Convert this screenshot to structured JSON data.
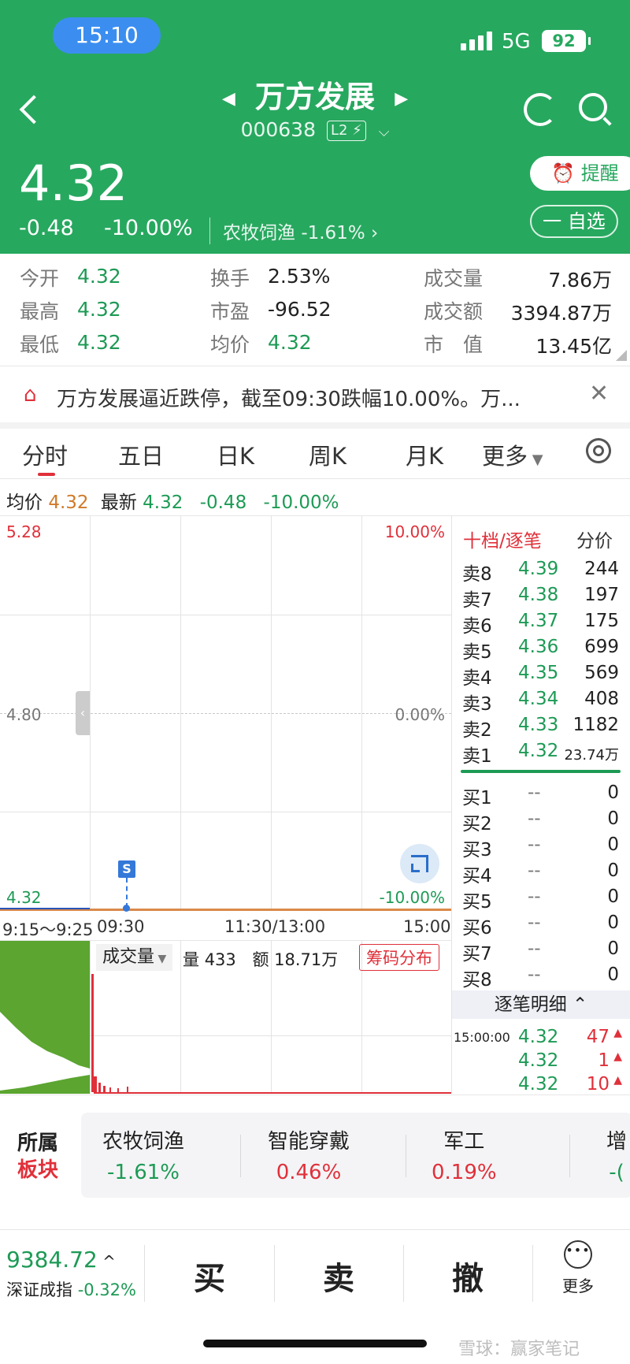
{
  "status": {
    "time": "15:10",
    "network": "5G",
    "battery": "92"
  },
  "header": {
    "name": "万方发展",
    "code": "000638",
    "level": "L2",
    "price": "4.32",
    "change": "-0.48",
    "change_pct": "-10.00%",
    "sector": "农牧饲渔",
    "sector_pct": "-1.61%",
    "remind_label": "提醒",
    "watch_label": "一 自选",
    "bg_color": "#27a85f"
  },
  "stats": [
    [
      {
        "label": "今开",
        "value": "4.32"
      },
      {
        "label": "换手",
        "value": "2.53%"
      },
      {
        "label": "成交量",
        "value": "7.86万"
      }
    ],
    [
      {
        "label": "最高",
        "value": "4.32"
      },
      {
        "label": "市盈",
        "value": "-96.52"
      },
      {
        "label": "成交额",
        "value": "3394.87万"
      }
    ],
    [
      {
        "label": "最低",
        "value": "4.32"
      },
      {
        "label": "均价",
        "value": "4.32"
      },
      {
        "label": "市　值",
        "value": "13.45亿"
      }
    ]
  ],
  "notice": {
    "text": "万方发展逼近跌停，截至09:30跌幅10.00%。万..."
  },
  "tabs": [
    "分时",
    "五日",
    "日K",
    "周K",
    "月K",
    "更多"
  ],
  "active_tab": "分时",
  "info_bar": {
    "avg_label": "均价",
    "avg_value": "4.32",
    "latest_label": "最新",
    "latest_value": "4.32",
    "change": "-0.48",
    "change_pct": "-10.00%"
  },
  "chart": {
    "y_high": "5.28",
    "y_mid": "4.80",
    "y_low": "4.32",
    "pct_high": "10.00%",
    "pct_mid": "0.00%",
    "pct_low": "-10.00%",
    "x_labels": [
      "9:15～9:25",
      "09:30",
      "11:30/13:00",
      "15:00"
    ],
    "marker": "S"
  },
  "volume": {
    "selector": "成交量",
    "vol_label": "量",
    "vol_value": "433",
    "amount_label": "额",
    "amount_value": "18.71万",
    "chip_button": "筹码分布"
  },
  "order_book": {
    "title": "十档/逐笔",
    "alt": "分价",
    "sells": [
      {
        "label": "卖8",
        "price": "4.39",
        "vol": "244"
      },
      {
        "label": "卖7",
        "price": "4.38",
        "vol": "197"
      },
      {
        "label": "卖6",
        "price": "4.37",
        "vol": "175"
      },
      {
        "label": "卖5",
        "price": "4.36",
        "vol": "699"
      },
      {
        "label": "卖4",
        "price": "4.35",
        "vol": "569"
      },
      {
        "label": "卖3",
        "price": "4.34",
        "vol": "408"
      },
      {
        "label": "卖2",
        "price": "4.33",
        "vol": "1182"
      },
      {
        "label": "卖1",
        "price": "4.32",
        "vol": "23.74万"
      }
    ],
    "buys": [
      {
        "label": "买1",
        "price": "--",
        "vol": "0"
      },
      {
        "label": "买2",
        "price": "--",
        "vol": "0"
      },
      {
        "label": "买3",
        "price": "--",
        "vol": "0"
      },
      {
        "label": "买4",
        "price": "--",
        "vol": "0"
      },
      {
        "label": "买5",
        "price": "--",
        "vol": "0"
      },
      {
        "label": "买6",
        "price": "--",
        "vol": "0"
      },
      {
        "label": "买7",
        "price": "--",
        "vol": "0"
      },
      {
        "label": "买8",
        "price": "--",
        "vol": "0"
      }
    ],
    "detail_title": "逐笔明细",
    "ticks": [
      {
        "time": "15:00:00",
        "price": "4.32",
        "vol": "47"
      },
      {
        "time": "",
        "price": "4.32",
        "vol": "1"
      },
      {
        "time": "",
        "price": "4.32",
        "vol": "10"
      }
    ]
  },
  "sectors": {
    "heading1": "所属",
    "heading2": "板块",
    "items": [
      {
        "name": "农牧饲渔",
        "pct": "-1.61%"
      },
      {
        "name": "智能穿戴",
        "pct": "0.46%"
      },
      {
        "name": "军工",
        "pct": "0.19%"
      },
      {
        "name": "增",
        "pct": "-("
      }
    ]
  },
  "bottom": {
    "index_value": "9384.72",
    "index_name": "深证成指",
    "index_pct": "-0.32%",
    "buy": "买",
    "sell": "卖",
    "cancel": "撤",
    "more": "更多",
    "watermark": "雪球：赢家笔记"
  }
}
